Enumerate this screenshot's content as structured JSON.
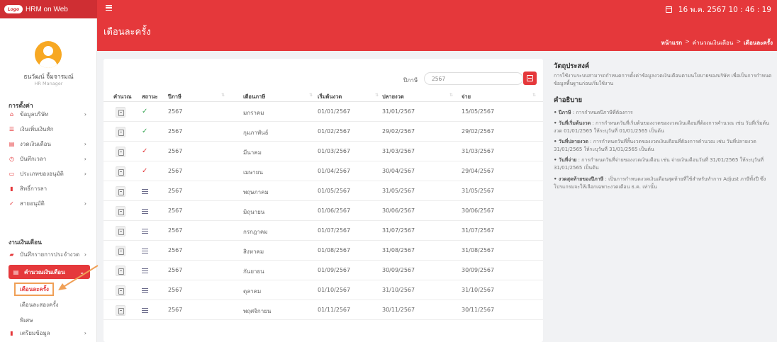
{
  "app": {
    "logo_text": "Logo",
    "title": "HRM on Web",
    "datetime": "16 พ.ค. 2567  10 : 46 : 19"
  },
  "user": {
    "name": "ธนวัฒน์ จิ้มจารมณ์",
    "role": "HR Manager"
  },
  "sidebar": {
    "section_settings": "การตั้งค่า",
    "settings_items": [
      {
        "icon": "home-icon",
        "label": "ข้อมูลบริษัท",
        "chevron": true
      },
      {
        "icon": "list-icon",
        "label": "เงินเพิ่มเงินหัก",
        "chevron": false
      },
      {
        "icon": "money-icon",
        "label": "งวดเงินเดือน",
        "chevron": true
      },
      {
        "icon": "clock-icon",
        "label": "บันทึกเวลา",
        "chevron": true
      },
      {
        "icon": "card-icon",
        "label": "ประเภทของอนุมัติ",
        "chevron": true
      },
      {
        "icon": "document-icon",
        "label": "สิทธิ์การลา",
        "chevron": false
      },
      {
        "icon": "approve-icon",
        "label": "สายอนุมัติ",
        "chevron": true
      }
    ],
    "section_payroll": "งานเงินเดือน",
    "payroll_items": [
      {
        "icon": "folder-icon",
        "label": "บันทึกรายการประจำงวด",
        "chevron": true
      }
    ],
    "active_item": {
      "icon": "money-icon",
      "label": "คำนวณเงินเดือน"
    },
    "submenu": [
      "เดือนละครั้ง",
      "เดือนละสองครั้ง",
      "พิเศษ"
    ],
    "after_items": [
      {
        "icon": "document-icon",
        "label": "เตรียมข้อมูล",
        "chevron": true
      }
    ]
  },
  "header": {
    "page_title": "เดือนละครั้ง",
    "breadcrumb": {
      "home": "หน้าแรก",
      "sep": ">",
      "parent": "คำนวณเงินเดือน",
      "current": "เดือนละครั้ง"
    }
  },
  "filter": {
    "label": "ปีภาษี",
    "value": "2567"
  },
  "table": {
    "columns": [
      "คำนวณ",
      "สถานะ",
      "ปีภาษี",
      "เดือนภาษี",
      "เริ่มต้นงวด",
      "ปลายงวด",
      "จ่าย"
    ],
    "rows": [
      {
        "status": "done",
        "year": "2567",
        "month": "มกราคม",
        "start": "01/01/2567",
        "end": "31/01/2567",
        "pay": "15/05/2567",
        "status_color": "#3aa655"
      },
      {
        "status": "done",
        "year": "2567",
        "month": "กุมภาพันธ์",
        "start": "01/02/2567",
        "end": "29/02/2567",
        "pay": "29/02/2567",
        "status_color": "#3aa655"
      },
      {
        "status": "done",
        "year": "2567",
        "month": "มีนาคม",
        "start": "01/03/2567",
        "end": "31/03/2567",
        "pay": "31/03/2567",
        "status_color": "#e5383b"
      },
      {
        "status": "done",
        "year": "2567",
        "month": "เมษายน",
        "start": "01/04/2567",
        "end": "30/04/2567",
        "pay": "29/04/2567",
        "status_color": "#e5383b"
      },
      {
        "status": "pending",
        "year": "2567",
        "month": "พฤษภาคม",
        "start": "01/05/2567",
        "end": "31/05/2567",
        "pay": "31/05/2567"
      },
      {
        "status": "pending",
        "year": "2567",
        "month": "มิถุนายน",
        "start": "01/06/2567",
        "end": "30/06/2567",
        "pay": "30/06/2567"
      },
      {
        "status": "pending",
        "year": "2567",
        "month": "กรกฎาคม",
        "start": "01/07/2567",
        "end": "31/07/2567",
        "pay": "31/07/2567"
      },
      {
        "status": "pending",
        "year": "2567",
        "month": "สิงหาคม",
        "start": "01/08/2567",
        "end": "31/08/2567",
        "pay": "31/08/2567"
      },
      {
        "status": "pending",
        "year": "2567",
        "month": "กันยายน",
        "start": "01/09/2567",
        "end": "30/09/2567",
        "pay": "30/09/2567"
      },
      {
        "status": "pending",
        "year": "2567",
        "month": "ตุลาคม",
        "start": "01/10/2567",
        "end": "31/10/2567",
        "pay": "31/10/2567"
      },
      {
        "status": "pending",
        "year": "2567",
        "month": "พฤศจิกายน",
        "start": "01/11/2567",
        "end": "30/11/2567",
        "pay": "30/11/2567"
      }
    ]
  },
  "info": {
    "objective_title": "วัตถุประสงค์",
    "objective_text": "การใช้งานระบบสามารถกำหนดการตั้งค่าข้อมูลงวดเงินเดือนตามนโยบายของบริษัท เพื่อเป็นการกำหนดข้อมูลพื้นฐานก่อนเริ่มใช้งาน",
    "desc_title": "คำอธิบาย",
    "items": [
      {
        "term": "ปีภาษี",
        "text": " : การกำหนดปีภาษีที่ต้องการ"
      },
      {
        "term": "วันที่เริ่มต้นงวด",
        "text": " : การกำหนดวันที่เริ่มต้นของงวดของงวดเงินเดือนที่ต้องการคำนวณ เช่น วันที่เริ่มต้นงวด 01/01/2565 ให้ระบุวันที่ 01/01/2565 เป็นต้น"
      },
      {
        "term": "วันที่ปลายงวด",
        "text": " : การกำหนดวันที่สิ้นงวดของงวดเงินเดือนที่ต้องการคำนวณ เช่น วันที่ปลายงวด 31/01/2565 ให้ระบุวันที่ 31/01/2565 เป็นต้น"
      },
      {
        "term": "วันที่จ่าย",
        "text": " : การกำหนดวันที่จ่ายของงวดเงินเดือน เช่น จ่ายเงินเดือนวันที่ 31/01/2565 ให้ระบุวันที่ 31/01/2565 เป็นต้น"
      },
      {
        "term": "งวดสุดท้ายของปีภาษี",
        "text": " : เป็นการกำหนดงวดเงินเดือนสุดท้ายที่ใช้สำหรับทำการ Adjust ภาษีทั้งปี ซึ่งโปรแกรมจะให้เลือกเฉพาะงวดเดือน ธ.ค. เท่านั้น"
      }
    ]
  },
  "colors": {
    "accent": "#e5383b",
    "highlight_border": "#f0a057",
    "done_green": "#3aa655"
  }
}
